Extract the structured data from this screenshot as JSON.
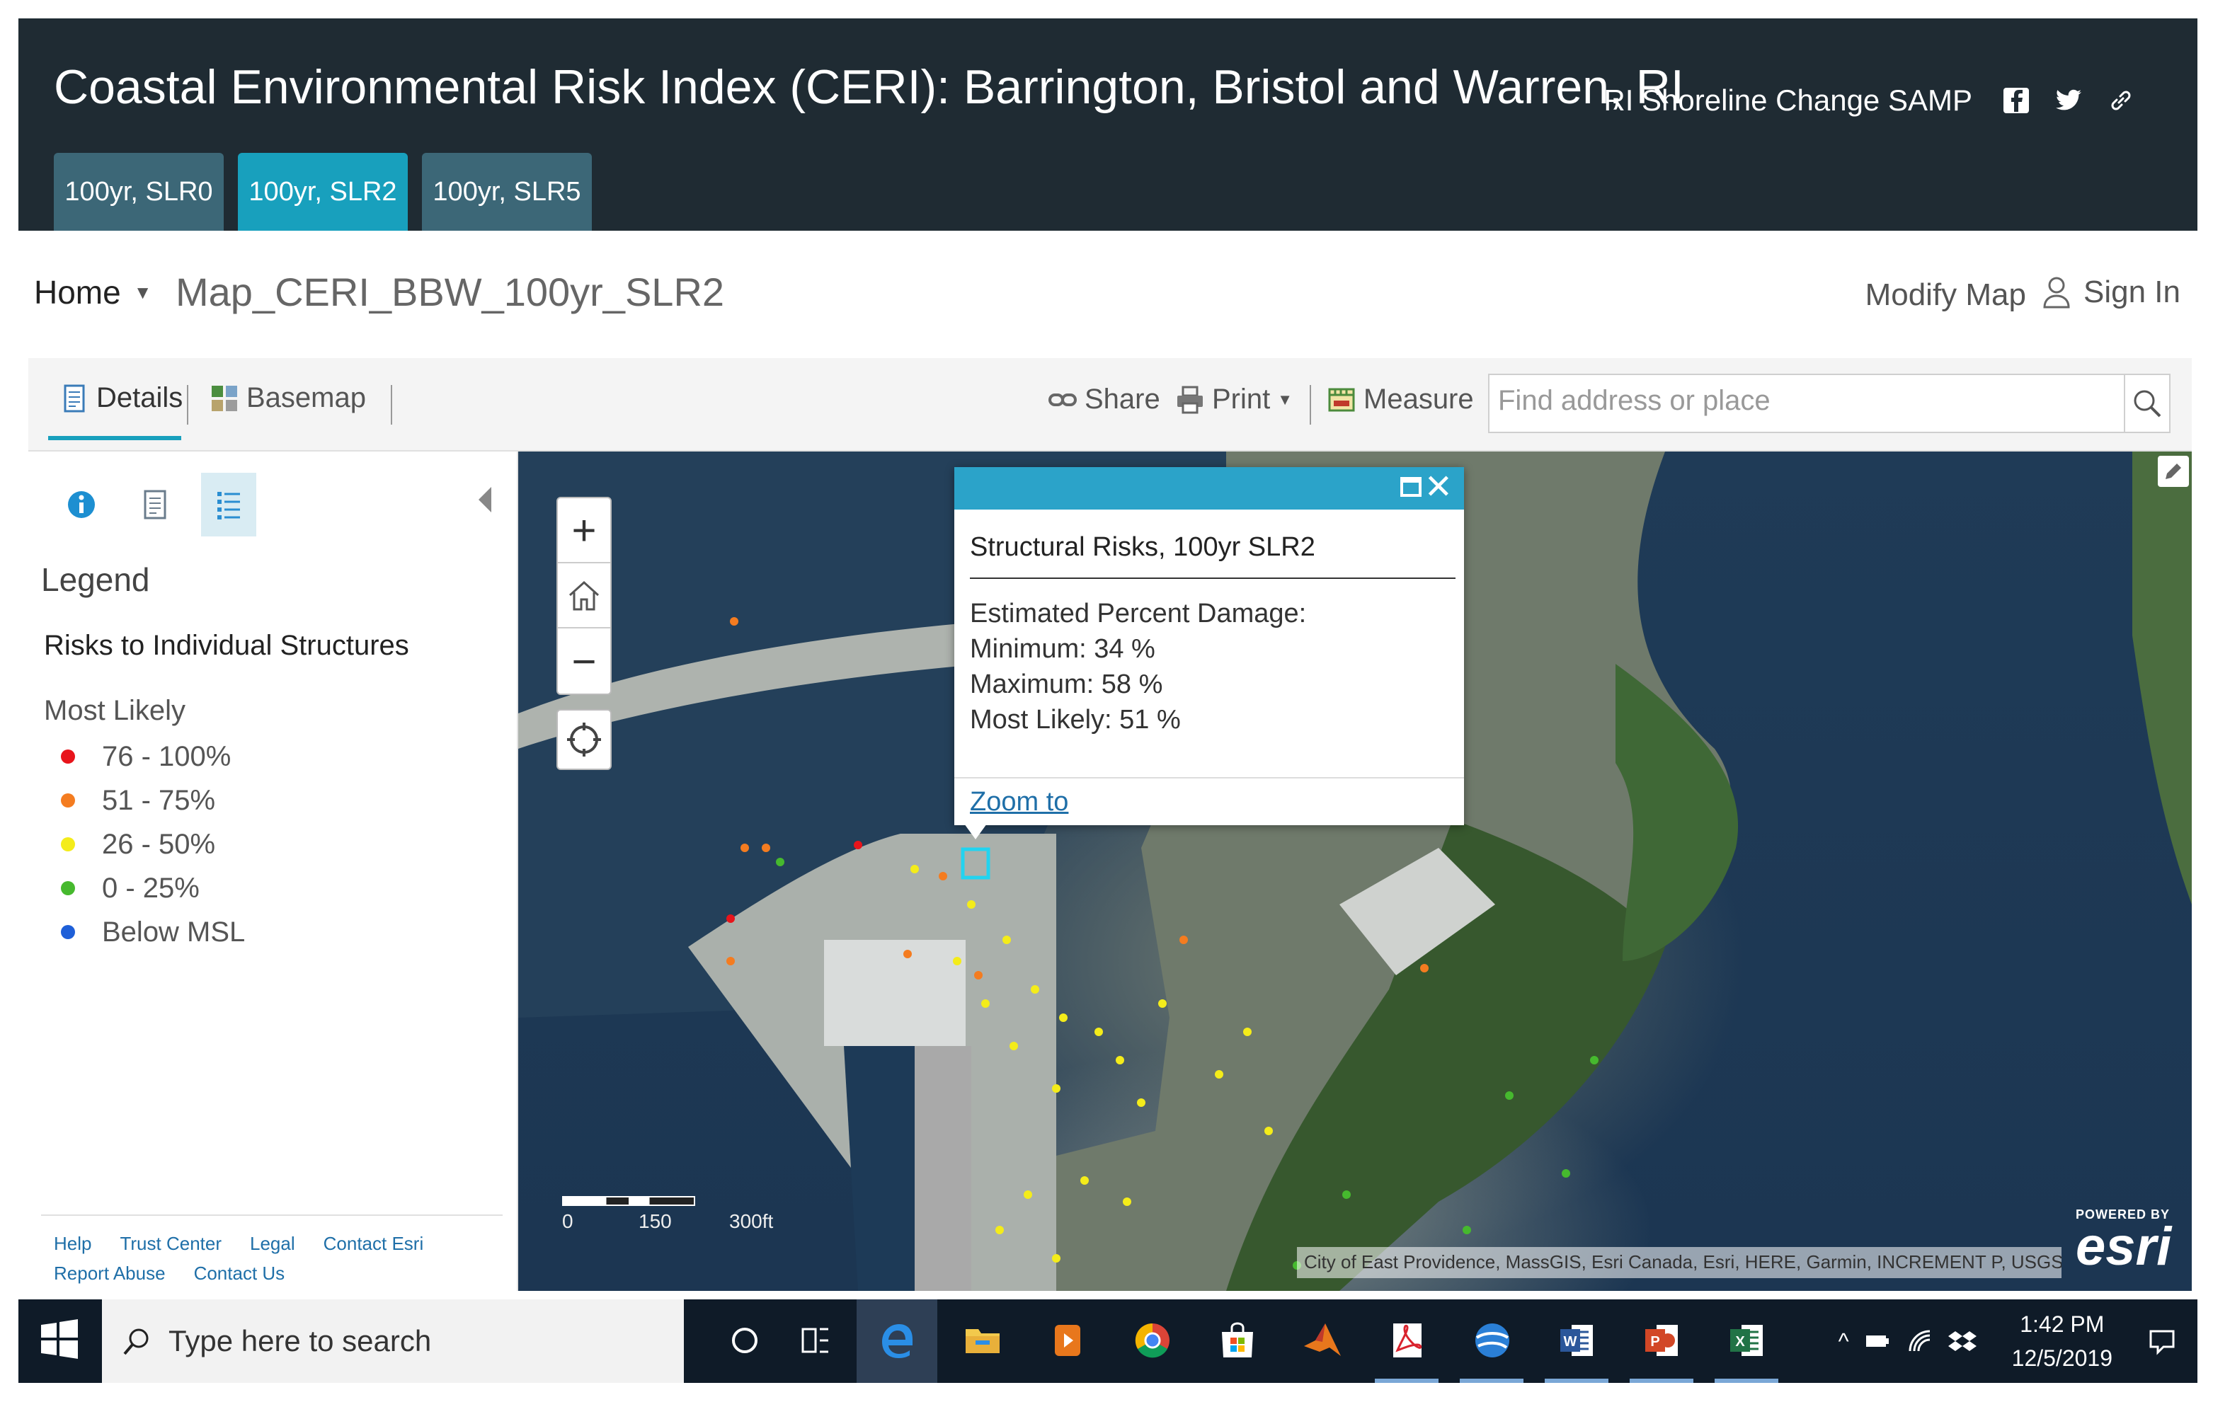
{
  "app": {
    "title": "Coastal Environmental Risk Index (CERI): Barrington, Bristol and Warren, RI",
    "header_link": "RI Shoreline Change SAMP",
    "header_icons": [
      "facebook-icon",
      "twitter-icon",
      "link-icon"
    ],
    "tabs": [
      {
        "label": "100yr, SLR0",
        "active": false
      },
      {
        "label": "100yr, SLR2",
        "active": true
      },
      {
        "label": "100yr, SLR5",
        "active": false
      }
    ],
    "colors": {
      "header_bg": "#1f2b33",
      "tab": "#3c6777",
      "tab_active": "#18a0bd"
    }
  },
  "breadcrumb": {
    "home": "Home",
    "map_name": "Map_CERI_BBW_100yr_SLR2",
    "modify_map": "Modify Map",
    "sign_in": "Sign In"
  },
  "toolbar": {
    "details": "Details",
    "basemap": "Basemap",
    "share": "Share",
    "print": "Print",
    "measure": "Measure",
    "search_placeholder": "Find address or place"
  },
  "legend": {
    "title": "Legend",
    "layer": "Risks to Individual Structures",
    "field": "Most Likely",
    "items": [
      {
        "label": "76 - 100%",
        "color": "#e8141b"
      },
      {
        "label": "51 - 75%",
        "color": "#f47c20"
      },
      {
        "label": "26 - 50%",
        "color": "#f4ec1a"
      },
      {
        "label": "0 - 25%",
        "color": "#46b92e"
      },
      {
        "label": "Below MSL",
        "color": "#1e5fd8"
      }
    ]
  },
  "footer": {
    "links_row1": [
      "Help",
      "Trust Center",
      "Legal",
      "Contact Esri"
    ],
    "links_row2": [
      "Report Abuse",
      "Contact Us"
    ]
  },
  "popup": {
    "title": "Structural Risks, 100yr SLR2",
    "label": "Estimated Percent Damage:",
    "minimum": "Minimum: 34 %",
    "maximum": "Maximum: 58 %",
    "most_likely": "Most Likely: 51 %",
    "zoom_to": "Zoom to"
  },
  "map": {
    "scale_labels": [
      "0",
      "150",
      "300ft"
    ],
    "attribution": "City of East Providence, MassGIS, Esri Canada, Esri, HERE, Garmin, INCREMENT P, USGS, EPA, ...",
    "powered_by": "POWERED BY",
    "logo": "esri"
  },
  "taskbar": {
    "search_placeholder": "Type here to search",
    "time": "1:42 PM",
    "date": "12/5/2019"
  }
}
